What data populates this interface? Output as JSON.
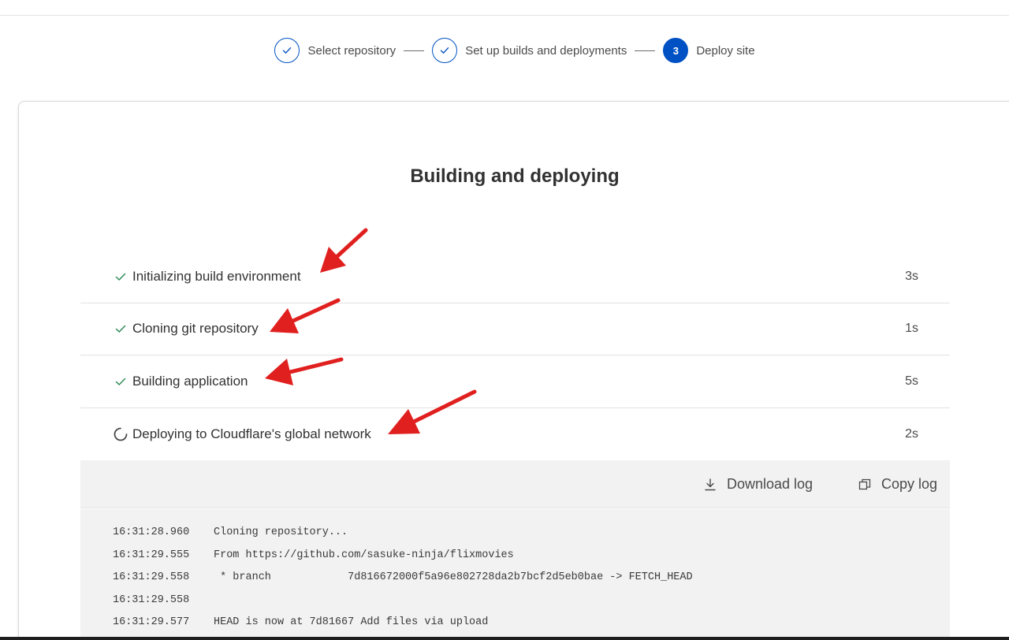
{
  "stepper": {
    "steps": [
      {
        "label": "Select repository",
        "state": "complete"
      },
      {
        "label": "Set up builds and deployments",
        "state": "complete"
      },
      {
        "label": "Deploy site",
        "number": "3",
        "state": "active"
      }
    ]
  },
  "main": {
    "title": "Building and deploying",
    "build_steps": [
      {
        "label": "Initializing build environment",
        "duration": "3s",
        "status": "done",
        "icon": "check-icon"
      },
      {
        "label": "Cloning git repository",
        "duration": "1s",
        "status": "done",
        "icon": "check-icon"
      },
      {
        "label": "Building application",
        "duration": "5s",
        "status": "done",
        "icon": "check-icon"
      },
      {
        "label": "Deploying to Cloudflare's global network",
        "duration": "2s",
        "status": "in-progress",
        "icon": "spinner-icon"
      }
    ],
    "log_toolbar": {
      "download_label": "Download log",
      "copy_label": "Copy log"
    },
    "log_lines": [
      {
        "time": "16:31:28.960",
        "text": "Cloning repository..."
      },
      {
        "time": "16:31:29.555",
        "text": "From https://github.com/sasuke-ninja/flixmovies"
      },
      {
        "time": "16:31:29.558",
        "text": " * branch            7d816672000f5a96e802728da2b7bcf2d5eb0bae -> FETCH_HEAD"
      },
      {
        "time": "16:31:29.558",
        "text": ""
      },
      {
        "time": "16:31:29.577",
        "text": "HEAD is now at 7d81667 Add files via upload"
      }
    ]
  },
  "colors": {
    "accent": "#0051c3",
    "success": "#2e8b57",
    "annotation_arrow": "#e0201f",
    "log_background": "#f2f2f2"
  }
}
